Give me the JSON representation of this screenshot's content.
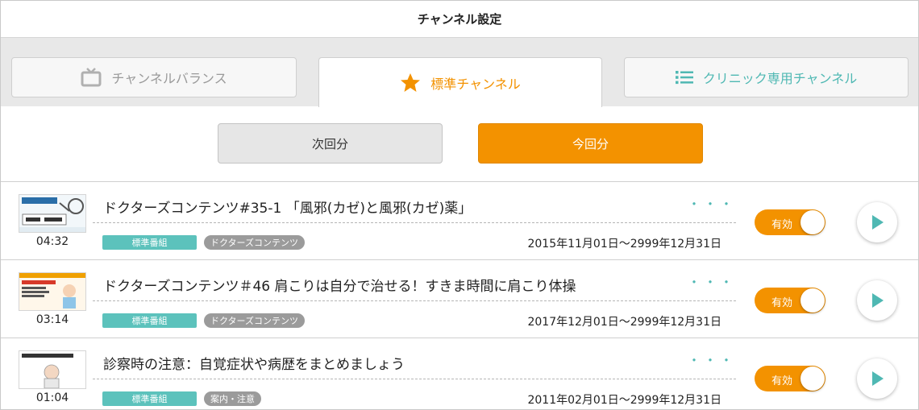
{
  "header": {
    "title": "チャンネル設定"
  },
  "tabs": [
    {
      "label": "チャンネルバランス",
      "icon": "tv-icon",
      "state": "inactive"
    },
    {
      "label": "標準チャンネル",
      "icon": "star-icon",
      "state": "active"
    },
    {
      "label": "クリニック専用チャンネル",
      "icon": "list-icon",
      "state": "inactive"
    }
  ],
  "segment": {
    "next_label": "次回分",
    "current_label": "今回分",
    "selected": "今回分"
  },
  "programs": [
    {
      "title": "ドクターズコンテンツ#35-1 「風邪(カゼ)と風邪(カゼ)薬」",
      "duration": "04:32",
      "tag_standard": "標準番組",
      "tag_category": "ドクターズコンテンツ",
      "period": "2015年11月01日～2999年12月31日",
      "more": "・・・",
      "toggle_label": "有効",
      "enabled": true
    },
    {
      "title": "ドクターズコンテンツ＃46 肩こりは自分で治せる！すきま時間に肩こり体操",
      "duration": "03:14",
      "tag_standard": "標準番組",
      "tag_category": "ドクターズコンテンツ",
      "period": "2017年12月01日～2999年12月31日",
      "more": "・・・",
      "toggle_label": "有効",
      "enabled": true
    },
    {
      "title": "診察時の注意：自覚症状や病歴をまとめましょう",
      "duration": "01:04",
      "tag_standard": "標準番組",
      "tag_category": "案内・注意",
      "period": "2011年02月01日～2999年12月31日",
      "more": "・・・",
      "toggle_label": "有効",
      "enabled": true
    }
  ],
  "colors": {
    "accent": "#f39200",
    "teal": "#4fb8b3",
    "tag_teal": "#5cc2bc",
    "tag_gray": "#9b9b9b"
  }
}
